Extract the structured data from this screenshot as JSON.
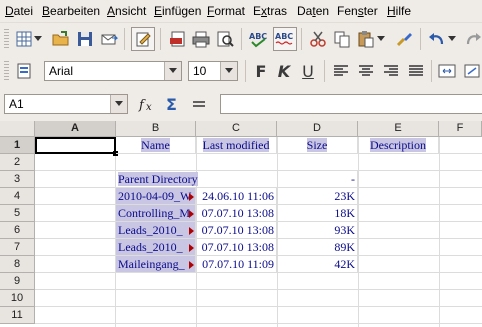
{
  "menubar": {
    "items": [
      {
        "pre": "",
        "u": "D",
        "post": "atei"
      },
      {
        "pre": "",
        "u": "B",
        "post": "earbeiten"
      },
      {
        "pre": "",
        "u": "A",
        "post": "nsicht"
      },
      {
        "pre": "",
        "u": "E",
        "post": "infügen"
      },
      {
        "pre": "",
        "u": "F",
        "post": "ormat"
      },
      {
        "pre": "E",
        "u": "x",
        "post": "tras"
      },
      {
        "pre": "Da",
        "u": "t",
        "post": "en"
      },
      {
        "pre": "Fen",
        "u": "s",
        "post": "ter"
      },
      {
        "pre": "",
        "u": "H",
        "post": "ilfe"
      }
    ]
  },
  "formatting": {
    "font_name": "Arial",
    "font_size": "10",
    "bold_label": "F",
    "italic_label": "K",
    "underline_label": "U"
  },
  "formula_bar": {
    "cell_ref": "A1",
    "content": ""
  },
  "sheet": {
    "columns": [
      "A",
      "B",
      "C",
      "D",
      "E",
      "F"
    ],
    "rows": [
      "1",
      "2",
      "3",
      "4",
      "5",
      "6",
      "7",
      "8",
      "9",
      "10",
      "11"
    ],
    "header_row": {
      "name": "Name",
      "modified": "Last modified",
      "size": "Size",
      "description": "Description"
    },
    "parent": "Parent Directory",
    "parent_size": "-",
    "entries": [
      {
        "name": "2010-04-09_W",
        "modified": "24.06.10 11:06",
        "size": "23K"
      },
      {
        "name": "Controlling_M",
        "modified": "07.07.10 13:08",
        "size": "18K"
      },
      {
        "name": "Leads_2010_",
        "modified": "07.07.10 13:08",
        "size": "93K"
      },
      {
        "name": "Leads_2010_",
        "modified": "07.07.10 13:08",
        "size": "89K"
      },
      {
        "name": "Maileingang_",
        "modified": "07.07.10 11:09",
        "size": "42K"
      }
    ]
  },
  "colors": {
    "text_link": "#0b0b8a",
    "highlight": "#c9c6e4",
    "chrome": "#efebe7"
  }
}
